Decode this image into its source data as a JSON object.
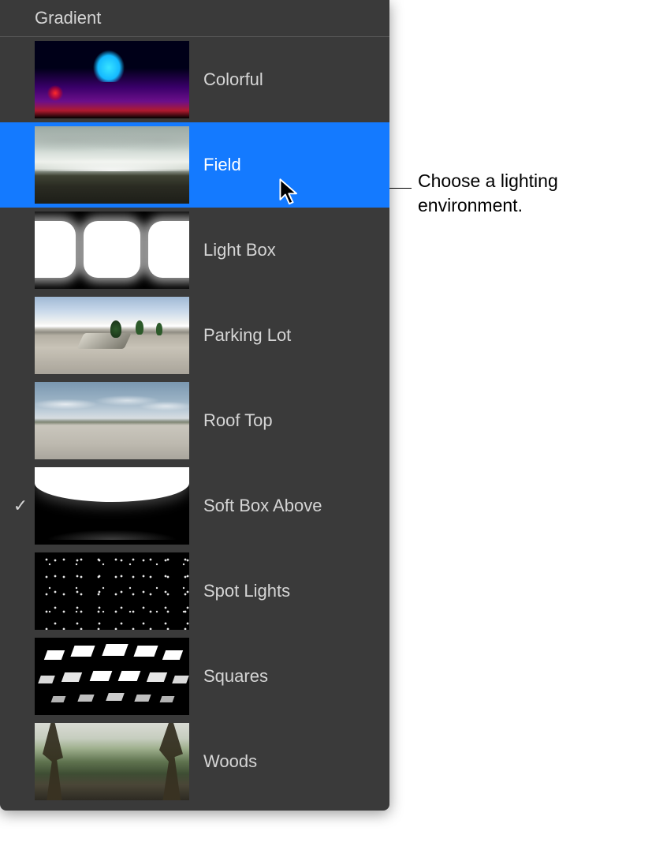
{
  "menu": {
    "header": "Gradient",
    "items": [
      {
        "label": "Colorful",
        "checked": false,
        "highlighted": false,
        "thumb": "colorful"
      },
      {
        "label": "Field",
        "checked": false,
        "highlighted": true,
        "thumb": "field"
      },
      {
        "label": "Light Box",
        "checked": false,
        "highlighted": false,
        "thumb": "lightbox"
      },
      {
        "label": "Parking Lot",
        "checked": false,
        "highlighted": false,
        "thumb": "parking"
      },
      {
        "label": "Roof Top",
        "checked": false,
        "highlighted": false,
        "thumb": "roof"
      },
      {
        "label": "Soft Box Above",
        "checked": true,
        "highlighted": false,
        "thumb": "softbox"
      },
      {
        "label": "Spot Lights",
        "checked": false,
        "highlighted": false,
        "thumb": "spot"
      },
      {
        "label": "Squares",
        "checked": false,
        "highlighted": false,
        "thumb": "squares"
      },
      {
        "label": "Woods",
        "checked": false,
        "highlighted": false,
        "thumb": "woods"
      }
    ]
  },
  "annotation": {
    "text": "Choose a lighting environment."
  },
  "checkmark_glyph": "✓",
  "colors": {
    "panel_bg": "#3a3a3a",
    "highlight": "#147aff",
    "text": "#d5d5d5",
    "text_highlight": "#ffffff"
  }
}
